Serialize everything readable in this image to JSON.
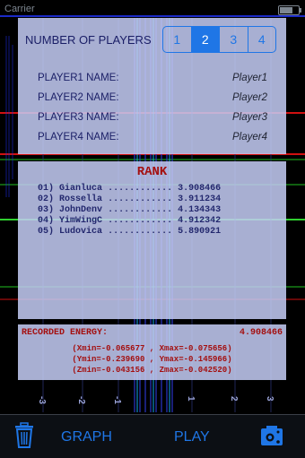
{
  "status_bar": {
    "carrier": "Carrier"
  },
  "players": {
    "number_label": "NUMBER OF PLAYERS",
    "options": [
      "1",
      "2",
      "3",
      "4"
    ],
    "selected": "2",
    "rows": [
      {
        "label": "PLAYER1 NAME:",
        "value": "Player1"
      },
      {
        "label": "PLAYER2 NAME:",
        "value": "Player2"
      },
      {
        "label": "PLAYER3 NAME:",
        "value": "Player3"
      },
      {
        "label": "PLAYER4 NAME:",
        "value": "Player4"
      }
    ]
  },
  "rank": {
    "title": "RANK",
    "entries": [
      {
        "pos": "01)",
        "name": "Gianluca",
        "dots": "............",
        "score": "3.908466"
      },
      {
        "pos": "02)",
        "name": "Rossella",
        "dots": "............",
        "score": "3.911234"
      },
      {
        "pos": "03)",
        "name": "JohnDenv",
        "dots": "............",
        "score": "4.134343"
      },
      {
        "pos": "04)",
        "name": "YimWingC",
        "dots": "............",
        "score": "4.912342"
      },
      {
        "pos": "05)",
        "name": "Ludovica",
        "dots": "............",
        "score": "5.890921"
      }
    ]
  },
  "energy": {
    "label": "RECORDED ENERGY:",
    "value": "4.908466",
    "lines": [
      "(Xmin=-0.065677 , Xmax=-0.075656)",
      "(Ymin=-0.239690 , Ymax=-0.145966)",
      "(Zmin=-0.043156 , Zmax=-0.042520)"
    ]
  },
  "toolbar": {
    "graph_label": "GRAPH",
    "play_label": "PLAY"
  },
  "colors": {
    "accent": "#1f76e6",
    "rank_red": "#a40f0f",
    "panel": "#c4ccf4"
  },
  "icons": [
    "trash-icon",
    "camera-settings-icon"
  ]
}
